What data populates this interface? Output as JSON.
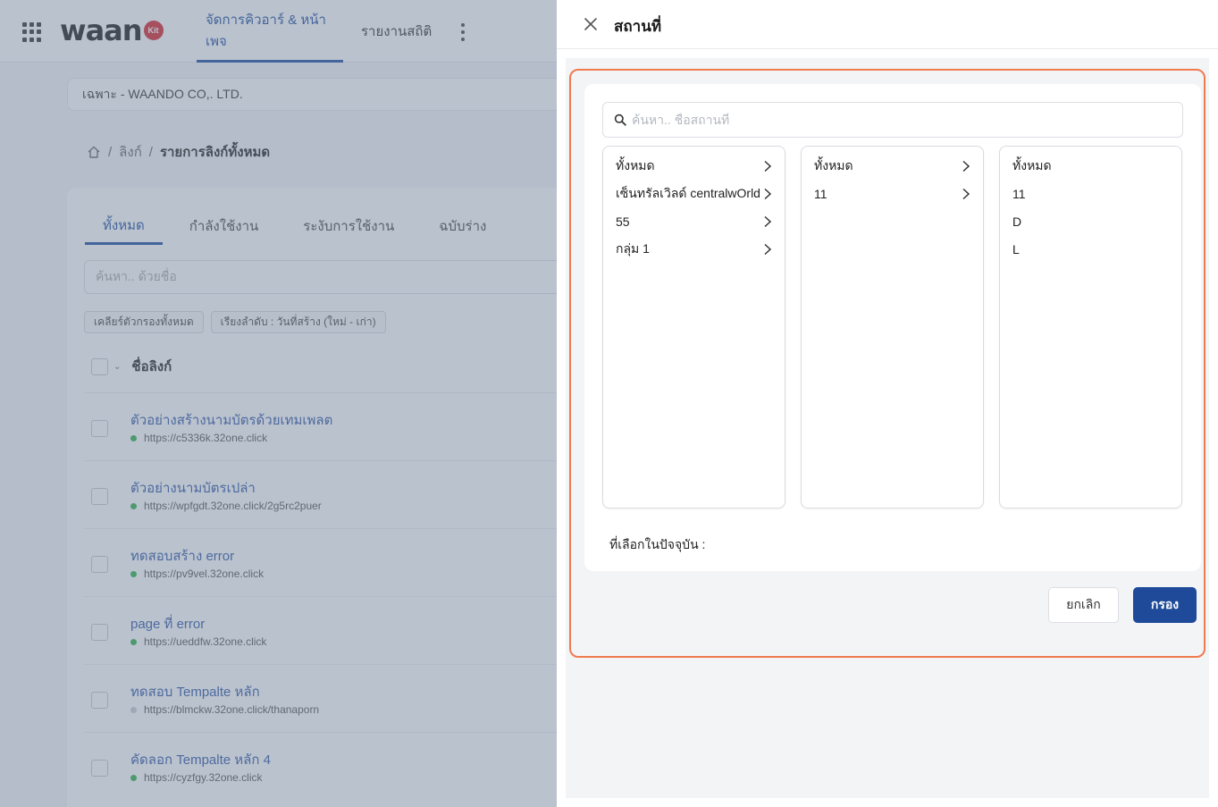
{
  "app": {
    "logo_text": "waan",
    "logo_badge": "Kit",
    "nav": [
      {
        "label": "จัดการคิวอาร์ & หน้าเพจ",
        "active": true
      },
      {
        "label": "รายงานสถิติ",
        "active": false
      }
    ],
    "organization": "เฉพาะ - WAANDO CO,. LTD.",
    "breadcrumb": {
      "links": "ลิงก์",
      "current": "รายการลิงก์ทั้งหมด",
      "sep": "/"
    },
    "tabs": [
      "ทั้งหมด",
      "กำลังใช้งาน",
      "ระงับการใช้งาน",
      "ฉบับร่าง"
    ],
    "search_placeholder": "ค้นหา.. ด้วยชื่อ",
    "chips": [
      "เคลียร์ตัวกรองทั้งหมด",
      "เรียงลำดับ : วันที่สร้าง (ใหม่ - เก่า)"
    ],
    "list_header": "ชื่อลิงก์",
    "rows": [
      {
        "title": "ตัวอย่างสร้างนามบัตรด้วยเทมเพลต",
        "url": "https://c5336k.32one.click",
        "status_color": "#2fb34a"
      },
      {
        "title": "ตัวอย่างนามบัตรเปล่า",
        "url": "https://wpfgdt.32one.click/2g5rc2puer",
        "status_color": "#2fb34a"
      },
      {
        "title": "ทดสอบสร้าง error",
        "url": "https://pv9vel.32one.click",
        "status_color": "#2fb34a"
      },
      {
        "title": "page ที่ error",
        "url": "https://ueddfw.32one.click",
        "status_color": "#2fb34a"
      },
      {
        "title": "ทดสอบ Tempalte หลัก",
        "url": "https://blmckw.32one.click/thanaporn",
        "status_color": "#c9ccd1"
      },
      {
        "title": "คัดลอก Tempalte หลัก 4",
        "url": "https://cyzfgy.32one.click",
        "status_color": "#2fb34a"
      }
    ]
  },
  "drawer": {
    "title": "สถานที่",
    "search_placeholder": "ค้นหา.. ชื่อสถานที่",
    "columns": [
      {
        "items": [
          {
            "label": "ทั้งหมด",
            "has_children": true
          },
          {
            "label": "เซ็นทรัลเวิลด์ centralwOrld",
            "has_children": true
          },
          {
            "label": "55",
            "has_children": true
          },
          {
            "label": "กลุ่ม 1",
            "has_children": true
          }
        ]
      },
      {
        "items": [
          {
            "label": "ทั้งหมด",
            "has_children": true
          },
          {
            "label": "11",
            "has_children": true
          }
        ]
      },
      {
        "items": [
          {
            "label": "ทั้งหมด",
            "has_children": false
          },
          {
            "label": "11",
            "has_children": false
          },
          {
            "label": "D",
            "has_children": false
          },
          {
            "label": "L",
            "has_children": false
          }
        ]
      }
    ],
    "selected_label": "ที่เลือกในปัจจุบัน :",
    "cancel_label": "ยกเลิก",
    "filter_label": "กรอง",
    "highlight_color": "#ef7b4f",
    "primary_color": "#1e4a99"
  }
}
